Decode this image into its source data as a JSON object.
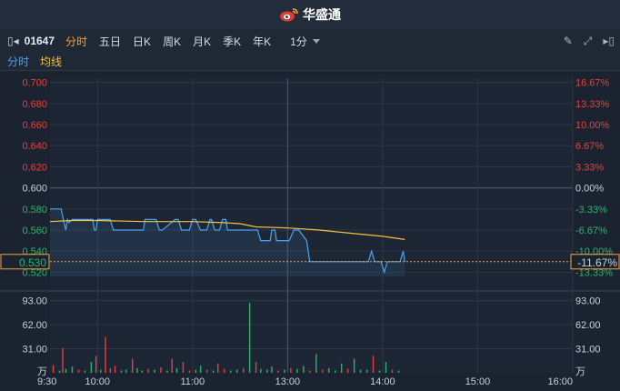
{
  "app": {
    "brand": "华盛通"
  },
  "toolbar": {
    "stock_code": "01647",
    "tabs": [
      {
        "label": "分时",
        "active": true
      },
      {
        "label": "五日",
        "active": false
      },
      {
        "label": "日K",
        "active": false
      },
      {
        "label": "周K",
        "active": false
      },
      {
        "label": "月K",
        "active": false
      },
      {
        "label": "季K",
        "active": false
      },
      {
        "label": "年K",
        "active": false
      }
    ],
    "period": "1分"
  },
  "legend": {
    "intraday": "分时",
    "average": "均线"
  },
  "chart_data": {
    "type": "line",
    "price_axis": {
      "labels": [
        "0.700",
        "0.680",
        "0.660",
        "0.640",
        "0.620",
        "0.600",
        "0.580",
        "0.560",
        "0.540",
        "0.520"
      ],
      "values": [
        0.7,
        0.68,
        0.66,
        0.64,
        0.62,
        0.6,
        0.58,
        0.56,
        0.54,
        0.52
      ],
      "ylim": [
        0.516,
        0.704
      ],
      "prev_close": 0.6
    },
    "pct_axis": {
      "labels": [
        "16.67%",
        "13.33%",
        "10.00%",
        "6.67%",
        "3.33%",
        "0.00%",
        "-3.33%",
        "-6.67%",
        "-10.00%",
        "-13.33%"
      ],
      "values": [
        0.7,
        0.68,
        0.66,
        0.64,
        0.62,
        0.6,
        0.58,
        0.56,
        0.54,
        0.52
      ]
    },
    "current": {
      "price": "0.530",
      "pct": "-11.67%",
      "value": 0.53
    },
    "volume_axis": {
      "labels": [
        "93.00",
        "62.00",
        "31.00",
        "万"
      ],
      "values": [
        93,
        62,
        31
      ],
      "ylim": [
        0,
        96
      ]
    },
    "time_axis": {
      "labels": [
        "9:30",
        "10:00",
        "11:00",
        "13:00",
        "14:00",
        "15:00",
        "16:00"
      ],
      "minutes": [
        0,
        30,
        90,
        150,
        210,
        270,
        330
      ]
    },
    "series": [
      {
        "name": "分时",
        "color": "#4aa3f0",
        "t": [
          0,
          7,
          9,
          10,
          11,
          12,
          14,
          27,
          28,
          29,
          30,
          38,
          40,
          43,
          49,
          55,
          59,
          60,
          61,
          67,
          69,
          71,
          79,
          81,
          83,
          88,
          90,
          92,
          95,
          99,
          101,
          102,
          104,
          107,
          109,
          111,
          112,
          131,
          133,
          134,
          136,
          139,
          140,
          142,
          143,
          144,
          151,
          154,
          157,
          162,
          164,
          166,
          181,
          201,
          203,
          205,
          209,
          211,
          213,
          215,
          221,
          223,
          224
        ],
        "values": [
          0.58,
          0.58,
          0.566,
          0.56,
          0.57,
          0.567,
          0.57,
          0.57,
          0.56,
          0.56,
          0.57,
          0.57,
          0.56,
          0.56,
          0.56,
          0.56,
          0.56,
          0.57,
          0.57,
          0.57,
          0.56,
          0.56,
          0.57,
          0.57,
          0.56,
          0.56,
          0.57,
          0.57,
          0.56,
          0.56,
          0.57,
          0.57,
          0.56,
          0.56,
          0.57,
          0.57,
          0.56,
          0.56,
          0.55,
          0.55,
          0.55,
          0.55,
          0.56,
          0.56,
          0.55,
          0.55,
          0.55,
          0.56,
          0.56,
          0.55,
          0.53,
          0.53,
          0.53,
          0.53,
          0.54,
          0.53,
          0.53,
          0.52,
          0.53,
          0.53,
          0.53,
          0.54,
          0.53
        ]
      },
      {
        "name": "均线",
        "color": "#f2c040",
        "t": [
          0,
          14,
          30,
          60,
          90,
          110,
          120,
          130,
          150,
          170,
          190,
          210,
          224
        ],
        "values": [
          0.568,
          0.569,
          0.569,
          0.568,
          0.568,
          0.567,
          0.566,
          0.563,
          0.562,
          0.56,
          0.557,
          0.554,
          0.551
        ]
      }
    ],
    "volume": {
      "t": [
        2,
        6,
        8,
        10,
        14,
        18,
        22,
        26,
        29,
        32,
        35,
        38,
        41,
        45,
        48,
        52,
        55,
        58,
        62,
        66,
        70,
        74,
        77,
        80,
        84,
        88,
        92,
        95,
        99,
        103,
        106,
        110,
        114,
        118,
        122,
        126,
        130,
        133,
        137,
        140,
        144,
        148,
        152,
        156,
        160,
        164,
        168,
        172,
        176,
        180,
        184,
        188,
        192,
        196,
        200,
        204,
        208,
        212,
        216,
        220
      ],
      "values": [
        10,
        3,
        32,
        5,
        8,
        4,
        3,
        14,
        22,
        4,
        46,
        6,
        9,
        3,
        4,
        18,
        6,
        3,
        5,
        4,
        7,
        3,
        18,
        6,
        14,
        3,
        4,
        9,
        4,
        3,
        12,
        5,
        3,
        4,
        6,
        90,
        14,
        5,
        4,
        8,
        3,
        4,
        6,
        5,
        9,
        3,
        24,
        4,
        6,
        3,
        12,
        5,
        18,
        4,
        4,
        22,
        3,
        14,
        4,
        3
      ],
      "colors": [
        "u",
        "d",
        "u",
        "d",
        "d",
        "u",
        "d",
        "d",
        "u",
        "d",
        "u",
        "u",
        "u",
        "d",
        "d",
        "u",
        "d",
        "d",
        "u",
        "d",
        "u",
        "d",
        "u",
        "d",
        "u",
        "u",
        "d",
        "d",
        "u",
        "d",
        "u",
        "u",
        "d",
        "d",
        "u",
        "d",
        "u",
        "d",
        "d",
        "d",
        "u",
        "d",
        "u",
        "d",
        "d",
        "u",
        "d",
        "u",
        "d",
        "d",
        "d",
        "u",
        "d",
        "d",
        "d",
        "u",
        "d",
        "d",
        "u",
        "d"
      ]
    },
    "grid": true
  }
}
